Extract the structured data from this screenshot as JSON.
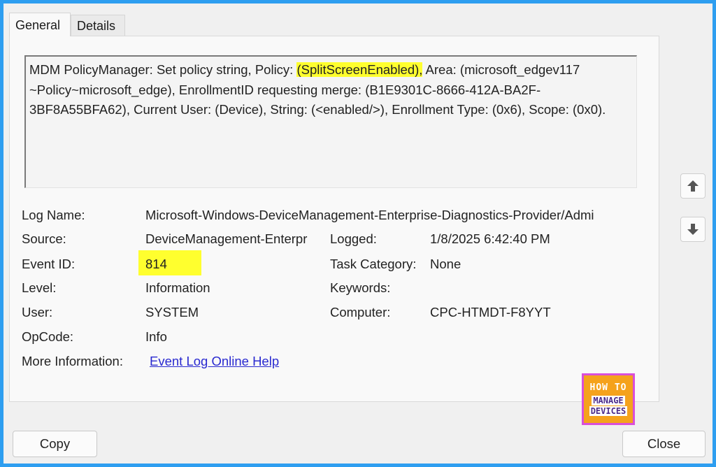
{
  "tabs": {
    "general": "General",
    "details": "Details"
  },
  "description": {
    "part1": "MDM PolicyManager: Set policy string, Policy: ",
    "policy_highlight": "(SplitScreenEnabled),",
    "part2": " Area: (microsoft_edgev117 ~Policy~microsoft_edge), EnrollmentID requesting merge: (B1E9301C-8666-412A-BA2F-3BF8A55BFA62), Current User: (Device), String: (<enabled/>), Enrollment Type: (0x6), Scope: (0x0)."
  },
  "fields": {
    "log_name_label": "Log Name:",
    "log_name_value": "Microsoft-Windows-DeviceManagement-Enterprise-Diagnostics-Provider/Admi",
    "source_label": "Source:",
    "source_value": "DeviceManagement-Enterpr",
    "logged_label": "Logged:",
    "logged_value": "1/8/2025 6:42:40 PM",
    "event_id_label": "Event ID:",
    "event_id_value": "814",
    "task_category_label": "Task Category:",
    "task_category_value": "None",
    "level_label": "Level:",
    "level_value": "Information",
    "keywords_label": "Keywords:",
    "keywords_value": "",
    "user_label": "User:",
    "user_value": "SYSTEM",
    "computer_label": "Computer:",
    "computer_value": "CPC-HTMDT-F8YYT",
    "opcode_label": "OpCode:",
    "opcode_value": "Info",
    "more_info_label": "More Information:",
    "more_info_link": "Event Log Online Help"
  },
  "buttons": {
    "copy": "Copy",
    "close": "Close"
  },
  "logo": {
    "line1": "HOW TO",
    "line2": "MANAGE",
    "line3": "DEVICES"
  },
  "icons": {
    "up": "arrow-up-icon",
    "down": "arrow-down-icon"
  },
  "colors": {
    "highlight": "#ffff2e",
    "border": "#2e9ef0",
    "link": "#2a2ad0"
  }
}
